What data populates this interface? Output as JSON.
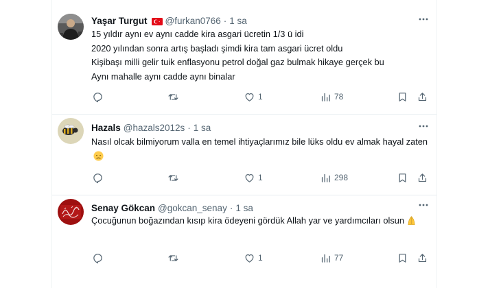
{
  "colors": {
    "text": "#0f1419",
    "secondary": "#536471",
    "separator": "#e6ecf0"
  },
  "tweets": [
    {
      "name": "Yaşar Turgut",
      "handle": "@furkan0766",
      "time": "1 sa",
      "flag_icon": "turkey-flag-icon",
      "lines": [
        "15 yıldır aynı ev aynı cadde kira asgari ücretin 1/3 ü idi",
        "2020 yılından sonra artış başladı şimdi kira tam asgari ücret oldu",
        "Kişibaşı milli gelir tuik enflasyonu petrol doğal gaz bulmak hikaye gerçek bu",
        "Aynı mahalle aynı cadde aynı binalar"
      ],
      "stats": {
        "likes": "1",
        "views": "78"
      }
    },
    {
      "name": "Hazals",
      "handle": "@hazals2012s",
      "time": "1 sa",
      "text": "Nasıl olcak bilmiyorum valla en temel ihtiyaçlarımız bile lüks oldu ev almak hayal zaten",
      "emoji_icon": "disappointed-face-emoji",
      "stats": {
        "likes": "1",
        "views": "298"
      }
    },
    {
      "name": "Senay Gökcan",
      "handle": "@gokcan_senay",
      "time": "1 sa",
      "text": "Çocuğunun boğazından kısıp kira ödeyeni gördük Allah yar ve yardımcıları olsun",
      "emoji_icon": "praying-hands-emoji",
      "stats": {
        "likes": "1",
        "views": "77"
      }
    }
  ],
  "separator_dot": "·"
}
